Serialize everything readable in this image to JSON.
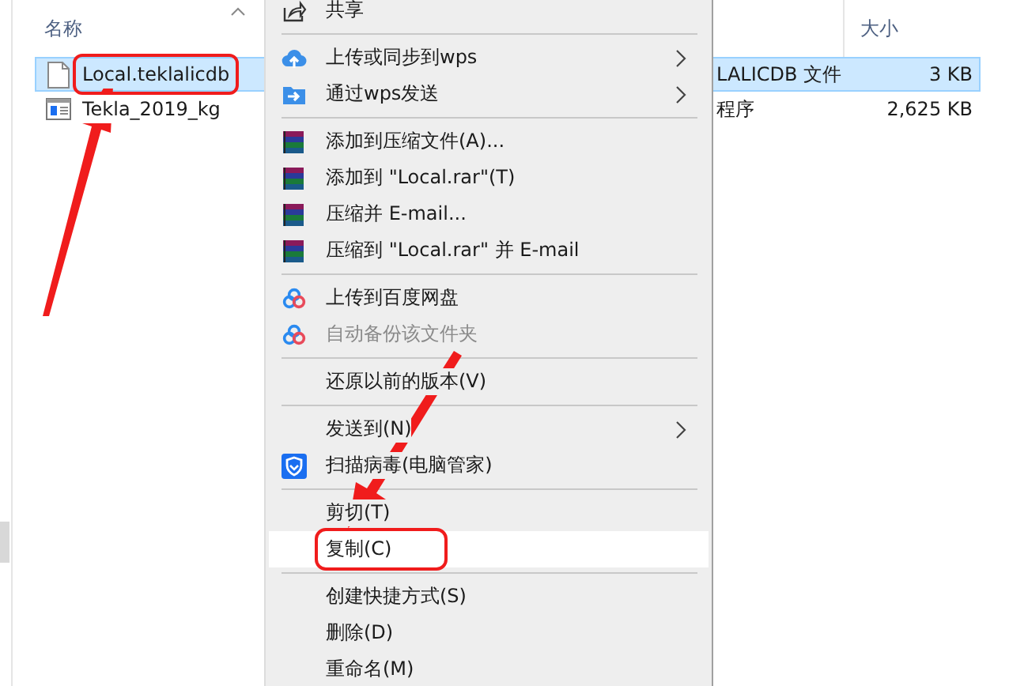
{
  "file_list": {
    "columns": [
      {
        "label": "名称",
        "sorted": true
      },
      {
        "label": "大小",
        "sorted": false
      }
    ],
    "rows": [
      {
        "name": "Local.teklalicdb",
        "kind": "document",
        "type": "LALICDB 文件",
        "size": "3 KB",
        "selected": true,
        "marked": true
      },
      {
        "name": "Tekla_2019_kg",
        "kind": "program",
        "type": "程序",
        "size": "2,625 KB",
        "selected": false,
        "marked": false
      }
    ]
  },
  "context_menu": {
    "items": [
      {
        "kind": "share",
        "label": "共享",
        "submenu": false,
        "disabled": false,
        "selected": false,
        "marked": false
      },
      {
        "kind": "separator"
      },
      {
        "kind": "cloud",
        "label": "上传或同步到wps",
        "submenu": true,
        "disabled": false,
        "selected": false,
        "marked": false
      },
      {
        "kind": "send",
        "label": "通过wps发送",
        "submenu": true,
        "disabled": false,
        "selected": false,
        "marked": false
      },
      {
        "kind": "separator"
      },
      {
        "kind": "archive",
        "label": "添加到压缩文件(A)...",
        "submenu": false,
        "disabled": false,
        "selected": false,
        "marked": false
      },
      {
        "kind": "archive",
        "label": "添加到 \"Local.rar\"(T)",
        "submenu": false,
        "disabled": false,
        "selected": false,
        "marked": false
      },
      {
        "kind": "archive",
        "label": "压缩并 E-mail...",
        "submenu": false,
        "disabled": false,
        "selected": false,
        "marked": false
      },
      {
        "kind": "archive",
        "label": "压缩到 \"Local.rar\" 并 E-mail",
        "submenu": false,
        "disabled": false,
        "selected": false,
        "marked": false
      },
      {
        "kind": "separator"
      },
      {
        "kind": "netdisk",
        "label": "上传到百度网盘",
        "submenu": false,
        "disabled": false,
        "selected": false,
        "marked": false
      },
      {
        "kind": "netdisk",
        "label": "自动备份该文件夹",
        "submenu": false,
        "disabled": true,
        "selected": false,
        "marked": false
      },
      {
        "kind": "separator"
      },
      {
        "kind": "plain",
        "label": "还原以前的版本(V)",
        "submenu": false,
        "disabled": false,
        "selected": false,
        "marked": false
      },
      {
        "kind": "separator"
      },
      {
        "kind": "plain",
        "label": "发送到(N)",
        "submenu": true,
        "disabled": false,
        "selected": false,
        "marked": false
      },
      {
        "kind": "shield",
        "label": "扫描病毒(电脑管家)",
        "submenu": false,
        "disabled": false,
        "selected": false,
        "marked": false
      },
      {
        "kind": "separator"
      },
      {
        "kind": "plain",
        "label": "剪切(T)",
        "submenu": false,
        "disabled": false,
        "selected": false,
        "marked": false
      },
      {
        "kind": "plain",
        "label": "复制(C)",
        "submenu": false,
        "disabled": false,
        "selected": true,
        "marked": true
      },
      {
        "kind": "separator"
      },
      {
        "kind": "plain",
        "label": "创建快捷方式(S)",
        "submenu": false,
        "disabled": false,
        "selected": false,
        "marked": false
      },
      {
        "kind": "plain",
        "label": "删除(D)",
        "submenu": false,
        "disabled": false,
        "selected": false,
        "marked": false
      },
      {
        "kind": "plain",
        "label": "重命名(M)",
        "submenu": false,
        "disabled": false,
        "selected": false,
        "marked": false
      }
    ]
  }
}
